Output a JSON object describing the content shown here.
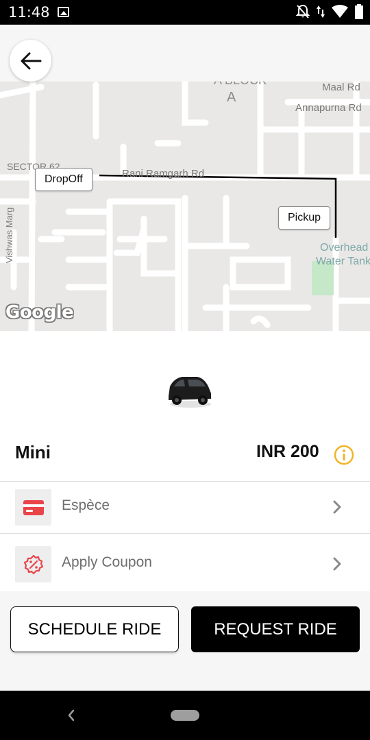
{
  "status_bar": {
    "time": "11:48",
    "icons": [
      "gallery-icon",
      "notifications-off-icon",
      "data-arrows-icon",
      "wifi-icon",
      "battery-icon"
    ]
  },
  "header": {
    "back_icon": "arrow-left-icon"
  },
  "map": {
    "labels": {
      "a_block": "A BLOCK",
      "a_letter": "A",
      "maal_rd": "Maal Rd",
      "annapurna_rd": "Annapurna Rd",
      "sector": "SECTOR 62",
      "rani_ramgarh_rd": "Rani Ramgarh Rd",
      "overhead_line1": "Overhead",
      "overhead_line2": "Water Tank",
      "vishwas_marg": "Vishwas Marg"
    },
    "markers": {
      "dropoff": "DropOff",
      "pickup": "Pickup"
    },
    "attribution": "Google"
  },
  "ride": {
    "name": "Mini",
    "price": "INR 200",
    "info_icon": "info-icon",
    "vehicle_image": "car-image"
  },
  "options": [
    {
      "label": "Espèce",
      "icon": "credit-card-icon"
    },
    {
      "label": "Apply Coupon",
      "icon": "coupon-percent-icon"
    }
  ],
  "actions": {
    "schedule": "SCHEDULE RIDE",
    "request": "REQUEST RIDE"
  },
  "colors": {
    "accent_red": "#e8444a",
    "info_yellow": "#f0b429",
    "primary_black": "#000000"
  }
}
